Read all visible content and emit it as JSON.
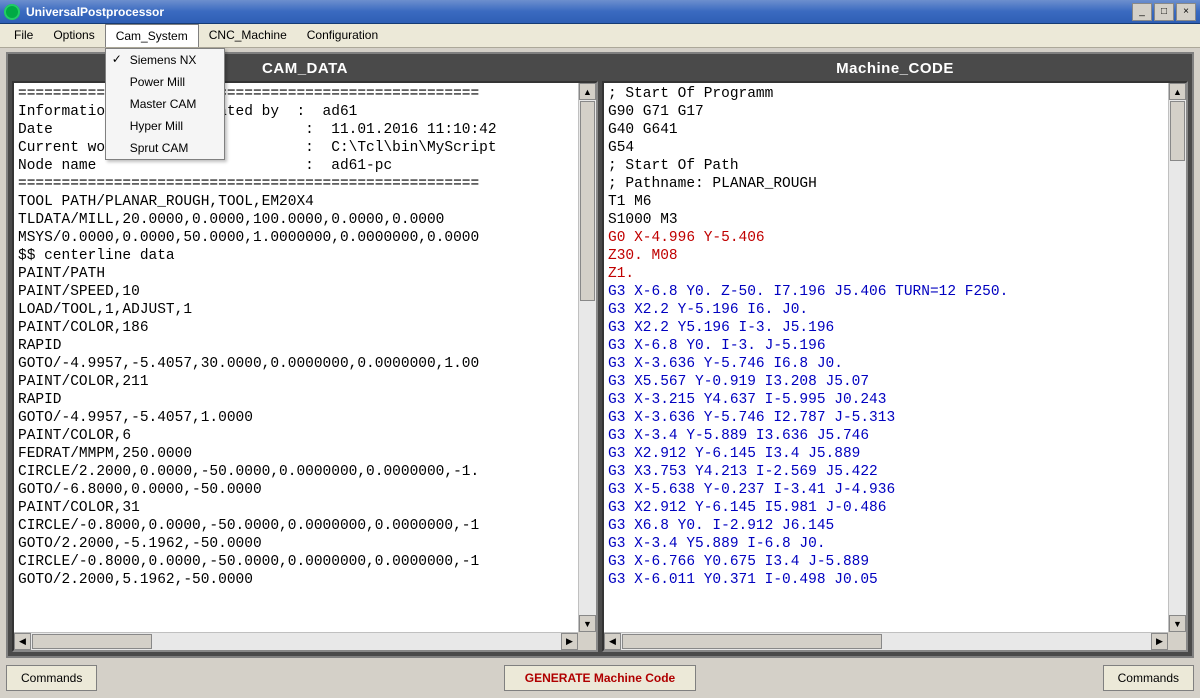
{
  "window": {
    "title": "UniversalPostprocessor"
  },
  "menubar": {
    "items": [
      "File",
      "Options",
      "Cam_System",
      "CNC_Machine",
      "Configuration"
    ],
    "open_index": 2
  },
  "cam_system_menu": {
    "items": [
      {
        "label": "Siemens NX",
        "checked": true
      },
      {
        "label": "Power Mill",
        "checked": false
      },
      {
        "label": "Master CAM",
        "checked": false
      },
      {
        "label": "Hyper Mill",
        "checked": false
      },
      {
        "label": "Sprut CAM",
        "checked": false
      }
    ]
  },
  "left_pane": {
    "title": "CAM_DATA",
    "lines": [
      "=====================================================",
      "Information Listing created by  :  ad61",
      "Date                             :  11.01.2016 11:10:42",
      "Current work part                :  C:\\Tcl\\bin\\MyScript",
      "Node name                        :  ad61-pc",
      "=====================================================",
      "TOOL PATH/PLANAR_ROUGH,TOOL,EM20X4",
      "TLDATA/MILL,20.0000,0.0000,100.0000,0.0000,0.0000",
      "MSYS/0.0000,0.0000,50.0000,1.0000000,0.0000000,0.0000",
      "$$ centerline data",
      "PAINT/PATH",
      "PAINT/SPEED,10",
      "LOAD/TOOL,1,ADJUST,1",
      "PAINT/COLOR,186",
      "RAPID",
      "GOTO/-4.9957,-5.4057,30.0000,0.0000000,0.0000000,1.00",
      "PAINT/COLOR,211",
      "RAPID",
      "GOTO/-4.9957,-5.4057,1.0000",
      "PAINT/COLOR,6",
      "FEDRAT/MMPM,250.0000",
      "CIRCLE/2.2000,0.0000,-50.0000,0.0000000,0.0000000,-1.",
      "GOTO/-6.8000,0.0000,-50.0000",
      "PAINT/COLOR,31",
      "CIRCLE/-0.8000,0.0000,-50.0000,0.0000000,0.0000000,-1",
      "GOTO/2.2000,-5.1962,-50.0000",
      "CIRCLE/-0.8000,0.0000,-50.0000,0.0000000,0.0000000,-1",
      "GOTO/2.2000,5.1962,-50.0000"
    ]
  },
  "right_pane": {
    "title": "Machine_CODE",
    "lines": [
      {
        "t": "; Start Of Programm",
        "c": "black"
      },
      {
        "t": "G90 G71 G17",
        "c": "black"
      },
      {
        "t": "G40 G641",
        "c": "black"
      },
      {
        "t": "G54",
        "c": "black"
      },
      {
        "t": "; Start Of Path",
        "c": "black"
      },
      {
        "t": "; Pathname: PLANAR_ROUGH",
        "c": "black"
      },
      {
        "t": "T1 M6",
        "c": "black"
      },
      {
        "t": "S1000 M3",
        "c": "black"
      },
      {
        "t": "G0 X-4.996 Y-5.406",
        "c": "red"
      },
      {
        "t": "Z30. M08",
        "c": "red"
      },
      {
        "t": "Z1.",
        "c": "red"
      },
      {
        "t": "G3 X-6.8 Y0. Z-50. I7.196 J5.406 TURN=12 F250.",
        "c": "blue"
      },
      {
        "t": "G3 X2.2 Y-5.196 I6. J0.",
        "c": "blue"
      },
      {
        "t": "G3 X2.2 Y5.196 I-3. J5.196",
        "c": "blue"
      },
      {
        "t": "G3 X-6.8 Y0. I-3. J-5.196",
        "c": "blue"
      },
      {
        "t": "G3 X-3.636 Y-5.746 I6.8 J0.",
        "c": "blue"
      },
      {
        "t": "G3 X5.567 Y-0.919 I3.208 J5.07",
        "c": "blue"
      },
      {
        "t": "G3 X-3.215 Y4.637 I-5.995 J0.243",
        "c": "blue"
      },
      {
        "t": "G3 X-3.636 Y-5.746 I2.787 J-5.313",
        "c": "blue"
      },
      {
        "t": "G3 X-3.4 Y-5.889 I3.636 J5.746",
        "c": "blue"
      },
      {
        "t": "G3 X2.912 Y-6.145 I3.4 J5.889",
        "c": "blue"
      },
      {
        "t": "G3 X3.753 Y4.213 I-2.569 J5.422",
        "c": "blue"
      },
      {
        "t": "G3 X-5.638 Y-0.237 I-3.41 J-4.936",
        "c": "blue"
      },
      {
        "t": "G3 X2.912 Y-6.145 I5.981 J-0.486",
        "c": "blue"
      },
      {
        "t": "G3 X6.8 Y0. I-2.912 J6.145",
        "c": "blue"
      },
      {
        "t": "G3 X-3.4 Y5.889 I-6.8 J0.",
        "c": "blue"
      },
      {
        "t": "G3 X-6.766 Y0.675 I3.4 J-5.889",
        "c": "blue"
      },
      {
        "t": "G3 X-6.011 Y0.371 I-0.498 J0.05",
        "c": "blue"
      }
    ]
  },
  "bottom": {
    "left_btn": "Commands",
    "center_btn": "GENERATE Machine Code",
    "right_btn": "Commands"
  }
}
